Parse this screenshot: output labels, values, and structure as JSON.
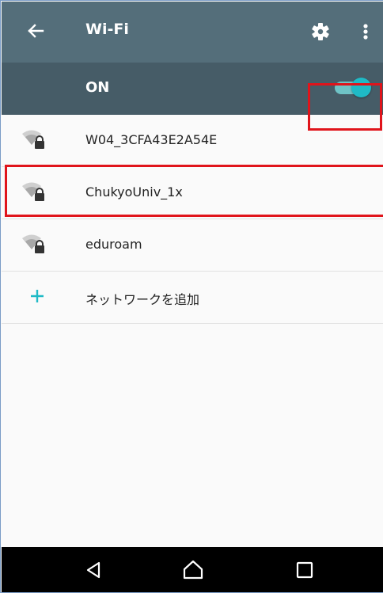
{
  "toolbar": {
    "back_icon": "arrow-back-icon",
    "title": "Wi-Fi",
    "settings_icon": "gear-icon",
    "more_icon": "more-vert-icon"
  },
  "master_switch": {
    "label": "ON",
    "state": "on",
    "accent_color": "#1fbac6"
  },
  "networks": [
    {
      "ssid": "W04_3CFA43E2A54E",
      "icon": "wifi-lock-icon",
      "highlighted": false
    },
    {
      "ssid": "ChukyoUniv_1x",
      "icon": "wifi-lock-icon",
      "highlighted": true
    },
    {
      "ssid": "eduroam",
      "icon": "wifi-lock-icon",
      "highlighted": false
    }
  ],
  "add_network": {
    "icon": "plus-icon",
    "label": "ネットワークを追加"
  },
  "nav_bar": {
    "back": "nav-back-icon",
    "home": "nav-home-icon",
    "recents": "nav-recents-icon"
  },
  "colors": {
    "toolbar": "#546e7a",
    "switch_bar": "#465c67",
    "highlight": "#e0141b",
    "accent": "#1fbac6"
  }
}
